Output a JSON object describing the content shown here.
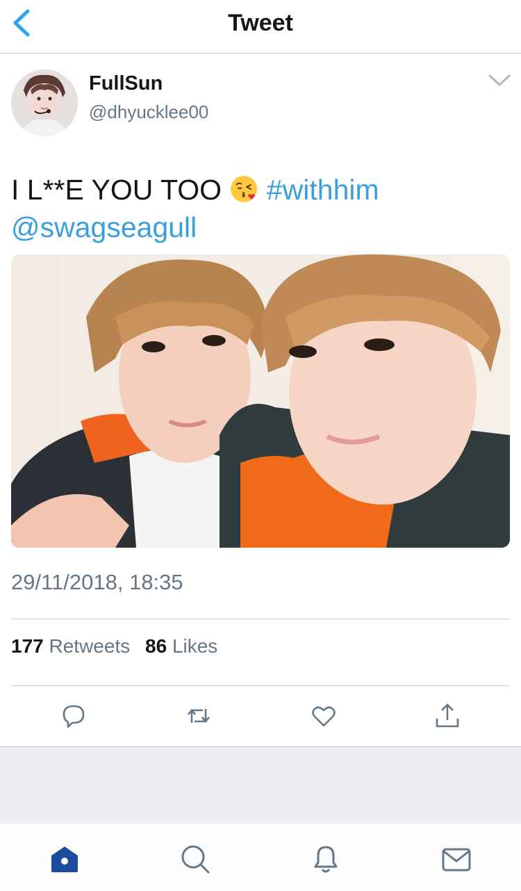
{
  "nav": {
    "title": "Tweet",
    "back_icon": "chevron-left-icon"
  },
  "tweet": {
    "author": {
      "display_name": "FullSun",
      "handle": "@dhyucklee00"
    },
    "text": "I L**E YOU TOO",
    "emoji": "face-blowing-kiss",
    "hashtag": "#withhim",
    "mention": "@swagseagull",
    "timestamp": "29/11/2018, 18:35",
    "stats": {
      "retweets_count": "177",
      "retweets_label": "Retweets",
      "likes_count": "86",
      "likes_label": "Likes"
    },
    "actions": [
      "reply-icon",
      "retweet-icon",
      "like-icon",
      "share-icon"
    ]
  },
  "tabbar": [
    "home-icon",
    "search-icon",
    "notifications-icon",
    "messages-icon"
  ],
  "colors": {
    "accent": "#1da1f2",
    "link": "#3a9fe0",
    "text": "#14171a",
    "secondary": "#657786",
    "tab_active": "#1c4d9c"
  }
}
